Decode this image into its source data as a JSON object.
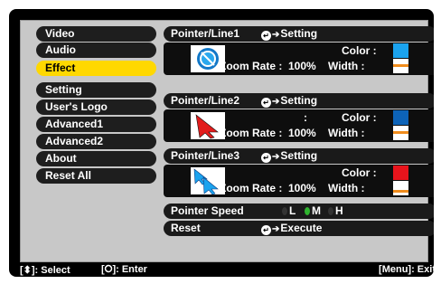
{
  "menu": [
    {
      "label": "Video"
    },
    {
      "label": "Audio"
    },
    {
      "label": "Effect"
    },
    {
      "label": "Setting"
    },
    {
      "label": "User's Logo"
    },
    {
      "label": "Advanced1"
    },
    {
      "label": "Advanced2"
    },
    {
      "label": "About"
    },
    {
      "label": "Reset All"
    }
  ],
  "selected": "Effect",
  "pointers": [
    {
      "title": "Pointer/Line1",
      "setting": "Setting",
      "zoom_label": "Zoom Rate :",
      "zoom": "100%",
      "color_label": "Color :",
      "width_label": "Width :",
      "color": "#1ba3ee",
      "width_color": "#f08c1c",
      "colon": ""
    },
    {
      "title": "Pointer/Line2",
      "setting": "Setting",
      "zoom_label": "Zoom Rate :",
      "zoom": "100%",
      "color_label": "Color :",
      "width_label": "Width :",
      "color": "#0d63b8",
      "width_color": "#f08c1c",
      "colon": ":"
    },
    {
      "title": "Pointer/Line3",
      "setting": "Setting",
      "zoom_label": "Zoom Rate :",
      "zoom": "100%",
      "color_label": "Color :",
      "width_label": "Width :",
      "color": "#e8141c",
      "width_color": "#f08c1c",
      "colon": ""
    }
  ],
  "pointer_speed": {
    "label": "Pointer Speed",
    "options": [
      "L",
      "M",
      "H"
    ],
    "selected": "M"
  },
  "reset": {
    "label": "Reset",
    "action": "Execute"
  },
  "status": {
    "select": "[⬍]: Select",
    "enter": "[⭘]: Enter",
    "exit": "[Menu]: Exit"
  }
}
